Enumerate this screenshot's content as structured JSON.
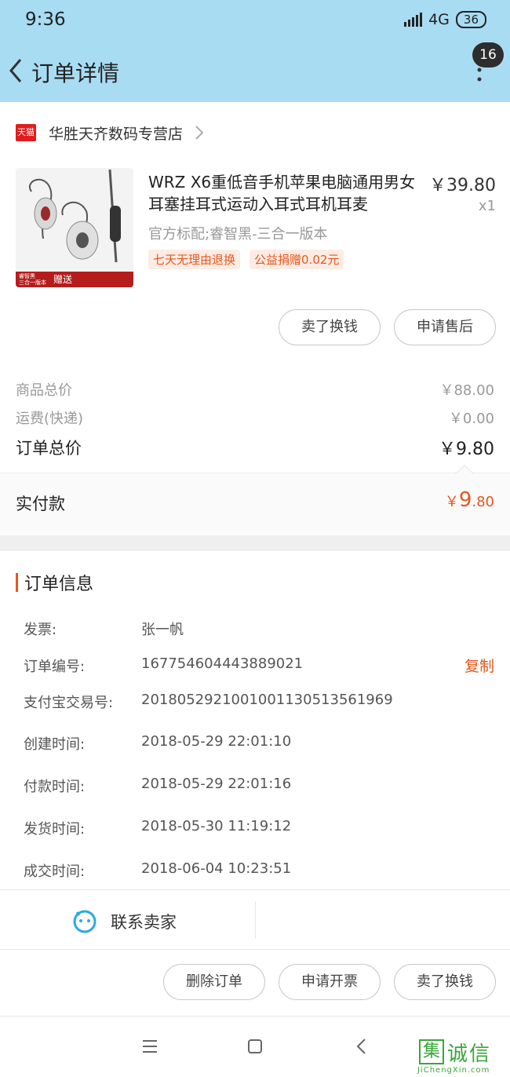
{
  "status_bar": {
    "time": "9:36",
    "network": "4G",
    "battery": "36"
  },
  "header": {
    "title": "订单详情",
    "badge_count": "16"
  },
  "store": {
    "platform_logo": "天猫",
    "name": "华胜天齐数码专营店"
  },
  "product": {
    "title": "WRZ X6重低音手机苹果电脑通用男女耳塞挂耳式运动入耳式耳机耳麦",
    "price": "￥39.80",
    "quantity": "x1",
    "spec": "官方标配;睿智黑-三合一版本",
    "tags": [
      "七天无理由退换",
      "公益捐赠0.02元"
    ],
    "image_banner_left": "睿智黑\n三合一版本",
    "image_banner_text": "赠送"
  },
  "item_actions": {
    "sell_for_cash": "卖了换钱",
    "after_sales": "申请售后"
  },
  "summary": {
    "goods_total_label": "商品总价",
    "goods_total_value": "￥88.00",
    "shipping_label": "运费(快递)",
    "shipping_value": "￥0.00",
    "order_total_label": "订单总价",
    "order_total_value": "￥9.80",
    "paid_label": "实付款",
    "paid_currency": "￥",
    "paid_int": "9",
    "paid_dec": ".80"
  },
  "order_info": {
    "title": "订单信息",
    "copy_label": "复制",
    "rows": [
      {
        "label": "发票:",
        "value": "张一帆"
      },
      {
        "label": "订单编号:",
        "value": "167754604443889021"
      },
      {
        "label": "支付宝交易号:",
        "value": "2018052921001001130513561969"
      },
      {
        "label": "创建时间:",
        "value": "2018-05-29 22:01:10"
      },
      {
        "label": "付款时间:",
        "value": "2018-05-29 22:01:16"
      },
      {
        "label": "发货时间:",
        "value": "2018-05-30 11:19:12"
      },
      {
        "label": "成交时间:",
        "value": "2018-06-04 10:23:51"
      }
    ]
  },
  "contact": {
    "label": "联系卖家"
  },
  "bottom_actions": {
    "delete_order": "删除订单",
    "request_invoice": "申请开票",
    "sell_for_cash": "卖了换钱"
  },
  "watermark": {
    "mark": "集",
    "text": "诚信",
    "sub": "JiChengXin.com"
  },
  "colors": {
    "header_bg": "#a8dcf2",
    "accent": "#e8561c",
    "tmall_red": "#e01d1d",
    "contact_icon": "#2aa9e0"
  }
}
